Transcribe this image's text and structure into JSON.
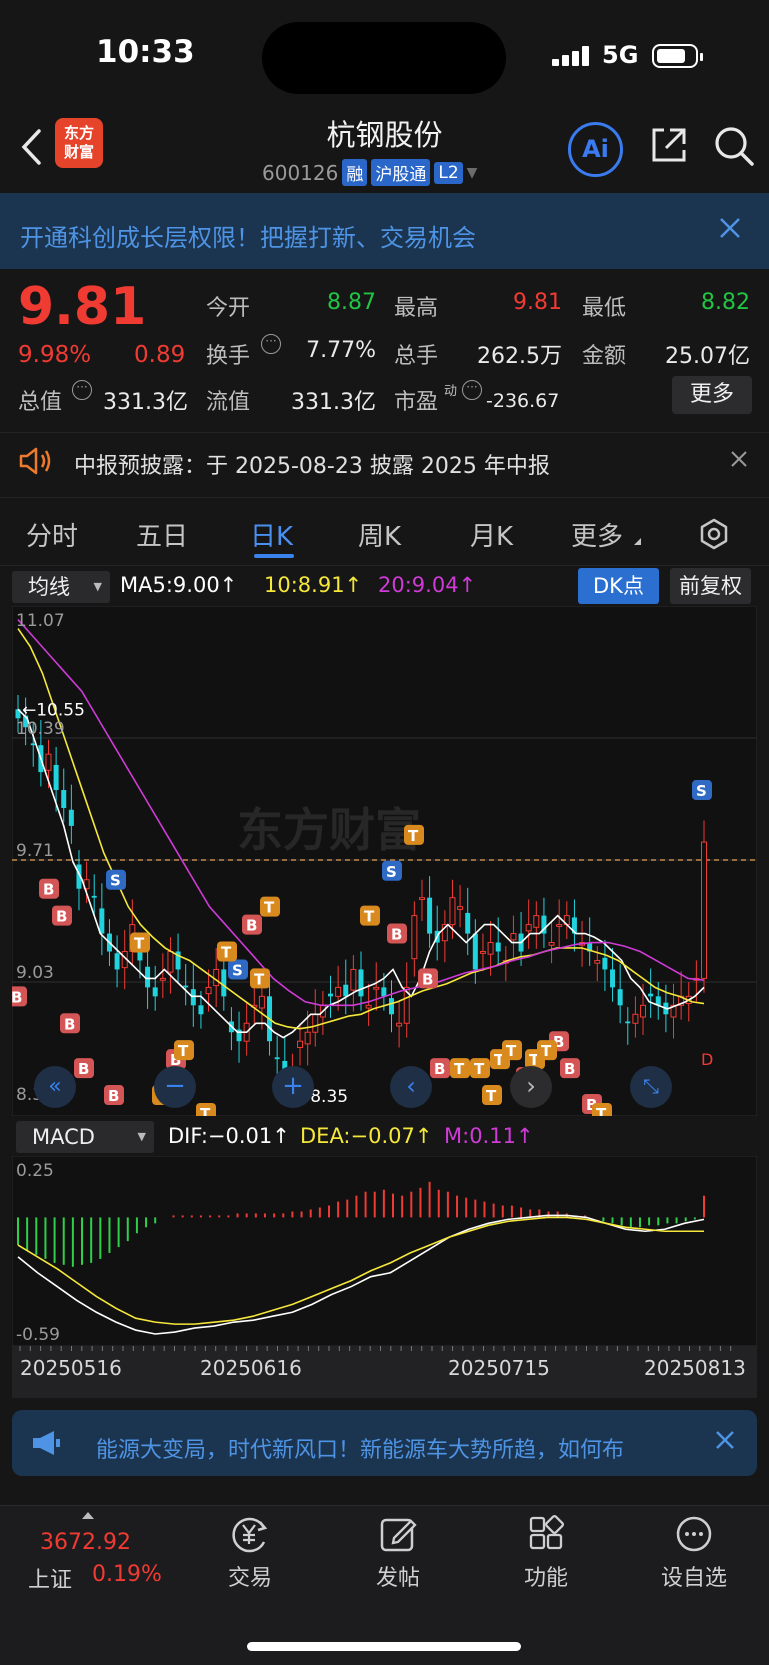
{
  "status_bar": {
    "time": "10:33",
    "network": "5G"
  },
  "nav": {
    "logo_line1": "东方",
    "logo_line2": "财富",
    "stock_name": "杭钢股份",
    "stock_code": "600126",
    "tags": [
      "融",
      "沪股通",
      "L2"
    ],
    "ai_label": "Ai"
  },
  "promo": {
    "text": "开通科创成长层权限！把握打新、交易机会"
  },
  "quote": {
    "price": "9.81",
    "change_pct": "9.98%",
    "change": "0.89",
    "open_label": "今开",
    "open": "8.87",
    "high_label": "最高",
    "high": "9.81",
    "low_label": "最低",
    "low": "8.82",
    "turnover_label": "换手",
    "turnover": "7.77%",
    "volume_label": "总手",
    "volume": "262.5万",
    "amount_label": "金额",
    "amount": "25.07亿",
    "mktcap_label": "总值",
    "mktcap": "331.3亿",
    "float_label": "流值",
    "float_cap": "331.3亿",
    "pe_label": "市盈",
    "pe_sup": "动",
    "pe": "-236.67",
    "more": "更多"
  },
  "notice": {
    "text": "中报预披露：于 2025-08-23 披露 2025 年中报"
  },
  "tabs": [
    "分时",
    "五日",
    "日K",
    "周K",
    "月K",
    "更多"
  ],
  "active_tab": "日K",
  "chart_header": {
    "indicator": "均线",
    "ma5": "MA5:9.00↑",
    "ma10": "10:8.91↑",
    "ma20": "20:9.04↑",
    "dk_label": "DK点",
    "adjust_label": "前复权",
    "watermark": "东方财富"
  },
  "macd_header": {
    "indicator": "MACD",
    "dif": "DIF:−0.01↑",
    "dea": "DEA:−0.07↑",
    "m": "M:0.11↑"
  },
  "news": {
    "text": "能源大变局，时代新风口！新能源车大势所趋，如何布"
  },
  "bottom_bar": {
    "index_value": "3672.92",
    "index_name": "上证",
    "index_change": "0.19%",
    "items": [
      "交易",
      "发帖",
      "功能",
      "设自选"
    ]
  },
  "colors": {
    "up": "#f03b33",
    "down": "#21d3dd",
    "ma5": "#ffffff",
    "ma10": "#f5e83a",
    "ma20": "#cf3bd6",
    "accent": "#3a82ee"
  },
  "chart_data": [
    {
      "type": "candlestick",
      "y_axis_labels": [
        "11.07",
        "10.39",
        "9.71",
        "9.03",
        "8.35"
      ],
      "ylim": [
        8.35,
        11.07
      ],
      "annotations": {
        "high": "←10.55",
        "low": "←8.35",
        "reference": "9.71"
      },
      "marker_labels": [
        "B",
        "S",
        "T",
        "D"
      ],
      "x_axis_labels": [
        "20250516",
        "20250616",
        "20250715",
        "20250813"
      ],
      "close": [
        10.5,
        10.45,
        10.35,
        10.2,
        10.3,
        10.1,
        10.0,
        9.9,
        9.55,
        9.6,
        9.5,
        9.3,
        9.2,
        9.1,
        9.2,
        9.35,
        9.15,
        9.0,
        8.95,
        9.05,
        9.2,
        9.1,
        9.0,
        8.9,
        8.85,
        9.0,
        9.1,
        8.95,
        8.75,
        8.7,
        8.8,
        8.9,
        8.95,
        8.7,
        8.6,
        8.5,
        8.55,
        8.7,
        8.75,
        8.85,
        8.9,
        8.95,
        9.0,
        8.95,
        9.1,
        8.95,
        8.9,
        9.0,
        8.95,
        8.85,
        8.8,
        9.0,
        9.4,
        9.5,
        9.3,
        9.25,
        9.35,
        9.5,
        9.45,
        9.3,
        9.1,
        9.2,
        9.25,
        9.2,
        9.15,
        9.3,
        9.2,
        9.35,
        9.4,
        9.3,
        9.25,
        9.35,
        9.4,
        9.3,
        9.25,
        9.2,
        9.15,
        9.1,
        9.0,
        8.9,
        8.8,
        8.85,
        8.9,
        8.95,
        8.9,
        8.85,
        8.9,
        8.95,
        8.95,
        9.05,
        9.81
      ],
      "ma5": [
        10.55,
        10.5,
        10.35,
        10.2,
        10.05,
        9.9,
        9.7,
        9.6,
        9.45,
        9.3,
        9.25,
        9.2,
        9.15,
        9.1,
        9.05,
        9.05,
        9.1,
        9.05,
        9.0,
        8.95,
        8.95,
        8.9,
        8.85,
        8.8,
        8.75,
        8.75,
        8.8,
        8.8,
        8.75,
        8.72,
        8.75,
        8.8,
        8.85,
        8.85,
        8.9,
        8.92,
        8.95,
        8.98,
        9.0,
        9.02,
        9.05,
        9.1,
        9.0,
        8.95,
        9.05,
        9.2,
        9.3,
        9.35,
        9.3,
        9.25,
        9.3,
        9.35,
        9.35,
        9.3,
        9.25,
        9.25,
        9.3,
        9.3,
        9.35,
        9.4,
        9.35,
        9.3,
        9.3,
        9.28,
        9.25,
        9.2,
        9.15,
        9.05,
        9.0,
        8.92,
        8.9,
        8.88,
        8.9,
        8.92,
        8.95,
        9.0
      ],
      "ma10": [
        11.0,
        10.9,
        10.75,
        10.55,
        10.35,
        10.15,
        9.95,
        9.75,
        9.6,
        9.45,
        9.35,
        9.28,
        9.22,
        9.18,
        9.15,
        9.1,
        9.05,
        9.0,
        8.95,
        8.9,
        8.85,
        8.8,
        8.78,
        8.77,
        8.78,
        8.8,
        8.82,
        8.84,
        8.85,
        8.88,
        8.9,
        8.92,
        8.95,
        8.98,
        9.0,
        9.02,
        9.05,
        9.08,
        9.1,
        9.12,
        9.15,
        9.17,
        9.18,
        9.2,
        9.22,
        9.22,
        9.22,
        9.2,
        9.18,
        9.15,
        9.1,
        9.05,
        9.0,
        8.97,
        8.95,
        8.92,
        8.91
      ],
      "ma20": [
        11.05,
        10.95,
        10.85,
        10.75,
        10.65,
        10.5,
        10.35,
        10.2,
        10.05,
        9.9,
        9.75,
        9.6,
        9.45,
        9.35,
        9.25,
        9.15,
        9.05,
        8.98,
        8.92,
        8.9,
        8.9,
        8.9,
        8.92,
        8.95,
        8.98,
        9.0,
        9.02,
        9.05,
        9.08,
        9.1,
        9.12,
        9.15,
        9.17,
        9.2,
        9.22,
        9.24,
        9.25,
        9.25,
        9.23,
        9.2,
        9.15,
        9.1,
        9.05,
        9.04
      ]
    },
    {
      "type": "macd",
      "y_axis_labels": [
        "0.25",
        "-0.59"
      ],
      "ylim": [
        -0.59,
        0.25
      ],
      "histogram": [
        -0.14,
        -0.17,
        -0.19,
        -0.21,
        -0.23,
        -0.24,
        -0.25,
        -0.24,
        -0.23,
        -0.21,
        -0.18,
        -0.15,
        -0.12,
        -0.08,
        -0.05,
        -0.03,
        0.0,
        0.01,
        0.01,
        0.01,
        0.01,
        0.01,
        0.01,
        0.01,
        0.02,
        0.02,
        0.02,
        0.02,
        0.02,
        0.02,
        0.03,
        0.03,
        0.04,
        0.05,
        0.06,
        0.08,
        0.09,
        0.11,
        0.13,
        0.13,
        0.14,
        0.12,
        0.11,
        0.13,
        0.15,
        0.18,
        0.14,
        0.13,
        0.11,
        0.1,
        0.09,
        0.08,
        0.07,
        0.06,
        0.06,
        0.05,
        0.04,
        0.04,
        0.03,
        0.03,
        0.02,
        0.01,
        0.01,
        0.0,
        -0.02,
        -0.03,
        -0.04,
        -0.05,
        -0.05,
        -0.04,
        -0.04,
        -0.03,
        -0.03,
        -0.02,
        -0.01,
        0.11
      ],
      "dif": [
        -0.2,
        -0.28,
        -0.35,
        -0.42,
        -0.48,
        -0.53,
        -0.57,
        -0.59,
        -0.58,
        -0.56,
        -0.55,
        -0.53,
        -0.52,
        -0.5,
        -0.48,
        -0.44,
        -0.39,
        -0.35,
        -0.3,
        -0.28,
        -0.22,
        -0.16,
        -0.1,
        -0.06,
        -0.03,
        -0.01,
        0.0,
        0.01,
        0.01,
        0.0,
        -0.03,
        -0.06,
        -0.07,
        -0.06,
        -0.03,
        -0.01
      ],
      "dea": [
        -0.14,
        -0.2,
        -0.26,
        -0.33,
        -0.4,
        -0.46,
        -0.51,
        -0.53,
        -0.54,
        -0.54,
        -0.53,
        -0.52,
        -0.5,
        -0.47,
        -0.44,
        -0.4,
        -0.36,
        -0.32,
        -0.27,
        -0.23,
        -0.18,
        -0.14,
        -0.1,
        -0.07,
        -0.04,
        -0.02,
        -0.01,
        0.0,
        0.0,
        -0.01,
        -0.03,
        -0.05,
        -0.06,
        -0.07,
        -0.07,
        -0.07
      ]
    }
  ]
}
